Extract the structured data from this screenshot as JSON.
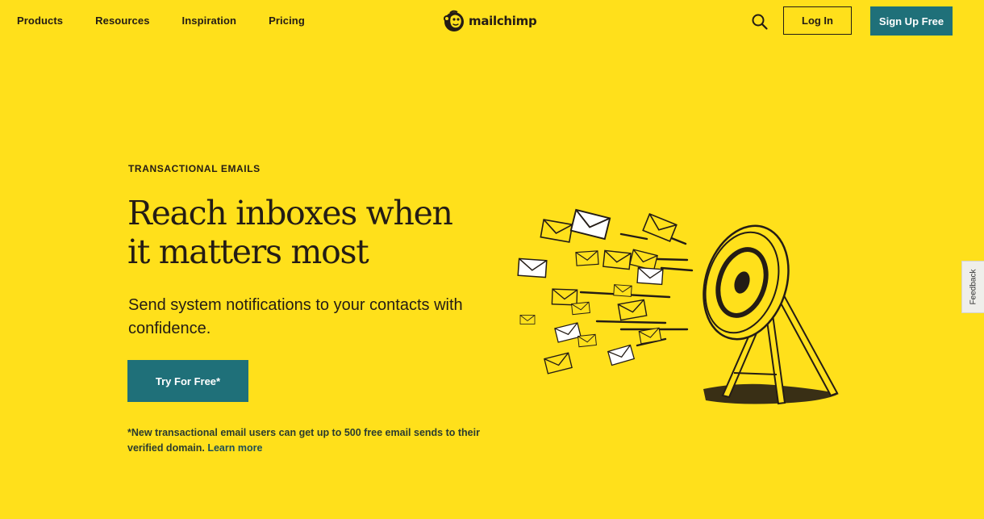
{
  "nav": {
    "links": [
      "Products",
      "Resources",
      "Inspiration",
      "Pricing"
    ],
    "logo_text": "mailchimp",
    "login_label": "Log In",
    "signup_label": "Sign Up Free"
  },
  "hero": {
    "eyebrow": "TRANSACTIONAL EMAILS",
    "headline_line1": "Reach inboxes when",
    "headline_line2": "it matters most",
    "subhead": "Send system notifications to your contacts with confidence.",
    "cta_label": "Try For Free*",
    "footnote": "*New transactional email users can get up to 500 free email sends to their verified domain.",
    "learn_more": "Learn more"
  },
  "feedback_label": "Feedback",
  "colors": {
    "background": "#FFE01B",
    "primary": "#1f7079",
    "text": "#241c15"
  },
  "icons": [
    "mailchimp-logo-icon",
    "search-icon",
    "envelope-icon",
    "target-icon"
  ]
}
